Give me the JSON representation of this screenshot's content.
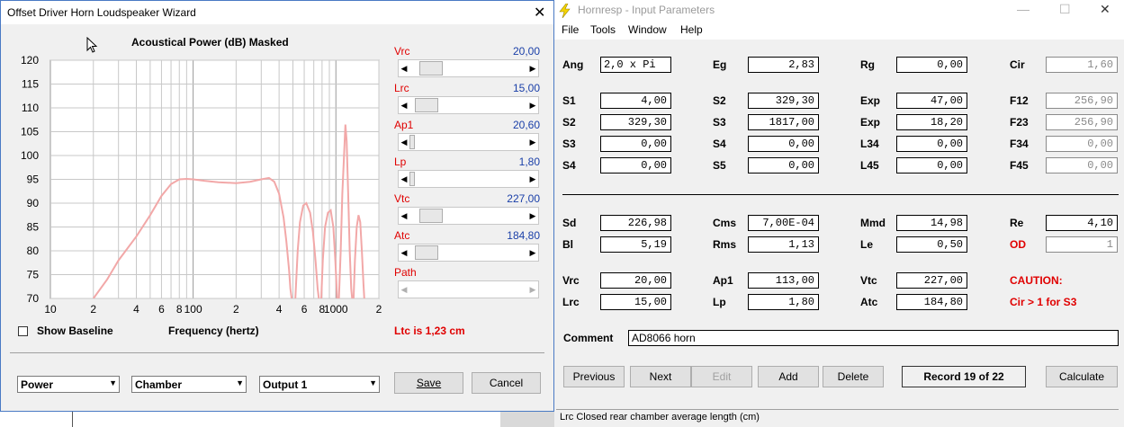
{
  "hornresp": {
    "title": "Hornresp - Input Parameters",
    "menu": [
      "File",
      "Tools",
      "Window",
      "Help"
    ],
    "row1": [
      {
        "label": "Ang",
        "value": "2,0 x Pi",
        "left": true
      },
      {
        "label": "Eg",
        "value": "2,83"
      },
      {
        "label": "Rg",
        "value": "0,00"
      },
      {
        "label": "Cir",
        "value": "1,60",
        "gray": true
      }
    ],
    "horn_rows": [
      [
        {
          "label": "S1",
          "value": "4,00"
        },
        {
          "label": "S2",
          "value": "329,30"
        },
        {
          "label": "Exp",
          "value": "47,00"
        },
        {
          "label": "F12",
          "value": "256,90",
          "gray": true
        }
      ],
      [
        {
          "label": "S2",
          "value": "329,30"
        },
        {
          "label": "S3",
          "value": "1817,00"
        },
        {
          "label": "Exp",
          "value": "18,20"
        },
        {
          "label": "F23",
          "value": "256,90",
          "gray": true
        }
      ],
      [
        {
          "label": "S3",
          "value": "0,00"
        },
        {
          "label": "S4",
          "value": "0,00"
        },
        {
          "label": "L34",
          "value": "0,00"
        },
        {
          "label": "F34",
          "value": "0,00",
          "gray": true
        }
      ],
      [
        {
          "label": "S4",
          "value": "0,00"
        },
        {
          "label": "S5",
          "value": "0,00"
        },
        {
          "label": "L45",
          "value": "0,00"
        },
        {
          "label": "F45",
          "value": "0,00",
          "gray": true
        }
      ]
    ],
    "driver_rows": [
      [
        {
          "label": "Sd",
          "value": "226,98"
        },
        {
          "label": "Cms",
          "value": "7,00E-04"
        },
        {
          "label": "Mmd",
          "value": "14,98"
        },
        {
          "label": "Re",
          "value": "4,10"
        }
      ],
      [
        {
          "label": "Bl",
          "value": "5,19"
        },
        {
          "label": "Rms",
          "value": "1,13"
        },
        {
          "label": "Le",
          "value": "0,50"
        },
        {
          "label": "OD",
          "value": "1",
          "red": true,
          "gray": true
        }
      ]
    ],
    "chamber_rows": [
      [
        {
          "label": "Vrc",
          "value": "20,00"
        },
        {
          "label": "Ap1",
          "value": "113,00"
        },
        {
          "label": "Vtc",
          "value": "227,00"
        }
      ],
      [
        {
          "label": "Lrc",
          "value": "15,00"
        },
        {
          "label": "Lp",
          "value": "1,80"
        },
        {
          "label": "Atc",
          "value": "184,80"
        }
      ]
    ],
    "caution_title": "CAUTION:",
    "caution_text": "Cir > 1 for S3",
    "comment_label": "Comment",
    "comment_value": "AD8066 horn",
    "buttons": {
      "previous": "Previous",
      "next": "Next",
      "edit": "Edit",
      "add": "Add",
      "delete": "Delete",
      "record": "Record 19 of 22",
      "calculate": "Calculate"
    },
    "status": "Lrc    Closed rear chamber average length  (cm)"
  },
  "wizard": {
    "title": "Offset Driver Horn Loudspeaker Wizard",
    "chart_title": "Acoustical Power (dB)   Masked",
    "show_baseline": "Show Baseline",
    "freq_label": "Frequency (hertz)",
    "ltc_text": "Ltc is 1,23 cm",
    "params": [
      {
        "label": "Vrc",
        "value": "20,00",
        "pos": 0.1
      },
      {
        "label": "Lrc",
        "value": "15,00",
        "pos": 0.06
      },
      {
        "label": "Ap1",
        "value": "20,60",
        "pos": 0.0
      },
      {
        "label": "Lp",
        "value": "1,80",
        "pos": 0.0
      },
      {
        "label": "Vtc",
        "value": "227,00",
        "pos": 0.1
      },
      {
        "label": "Atc",
        "value": "184,80",
        "pos": 0.06
      },
      {
        "label": "Path",
        "value": "",
        "pos": null
      }
    ],
    "combos": [
      "Power",
      "Chamber",
      "Output 1"
    ],
    "save": "Save",
    "cancel": "Cancel"
  },
  "chart_data": {
    "type": "line",
    "title": "Acoustical Power (dB)   Masked",
    "xlabel": "Frequency (hertz)",
    "ylabel": "",
    "xscale": "log",
    "xlim": [
      10,
      2000
    ],
    "ylim": [
      70,
      120
    ],
    "yticks": [
      70,
      75,
      80,
      85,
      90,
      95,
      100,
      105,
      110,
      115,
      120
    ],
    "xtick_labels": [
      {
        "v": 10,
        "t": "10"
      },
      {
        "v": 20,
        "t": "2"
      },
      {
        "v": 40,
        "t": "4"
      },
      {
        "v": 60,
        "t": "6"
      },
      {
        "v": 80,
        "t": "8"
      },
      {
        "v": 100,
        "t": "100"
      },
      {
        "v": 200,
        "t": "2"
      },
      {
        "v": 400,
        "t": "4"
      },
      {
        "v": 600,
        "t": "6"
      },
      {
        "v": 800,
        "t": "8"
      },
      {
        "v": 1000,
        "t": "1000"
      },
      {
        "v": 2000,
        "t": "2"
      }
    ],
    "grid": true,
    "color": "#f2a8a8",
    "series": [
      {
        "points": [
          [
            20,
            70
          ],
          [
            25,
            74
          ],
          [
            30,
            78
          ],
          [
            40,
            83
          ],
          [
            50,
            87.5
          ],
          [
            60,
            91.5
          ],
          [
            70,
            94
          ],
          [
            80,
            95
          ],
          [
            90,
            95.1
          ],
          [
            100,
            95
          ],
          [
            120,
            94.7
          ],
          [
            150,
            94.4
          ],
          [
            200,
            94.2
          ],
          [
            250,
            94.5
          ],
          [
            300,
            95
          ],
          [
            340,
            95.3
          ],
          [
            370,
            94.5
          ],
          [
            400,
            92
          ],
          [
            430,
            87
          ],
          [
            450,
            82
          ],
          [
            470,
            76
          ],
          [
            480,
            72
          ],
          [
            490,
            70
          ]
        ]
      },
      {
        "points": [
          [
            520,
            70
          ],
          [
            540,
            80
          ],
          [
            560,
            86
          ],
          [
            590,
            89.5
          ],
          [
            620,
            90
          ],
          [
            660,
            88
          ],
          [
            690,
            84
          ],
          [
            720,
            78
          ],
          [
            745,
            72
          ],
          [
            760,
            70
          ]
        ]
      },
      {
        "points": [
          [
            790,
            70
          ],
          [
            810,
            78
          ],
          [
            840,
            85
          ],
          [
            880,
            88
          ],
          [
            920,
            88.5
          ],
          [
            960,
            85
          ],
          [
            990,
            78
          ],
          [
            1010,
            73
          ],
          [
            1020,
            70
          ]
        ]
      },
      {
        "points": [
          [
            1050,
            70
          ],
          [
            1080,
            80
          ],
          [
            1110,
            92
          ],
          [
            1140,
            100
          ],
          [
            1165,
            106.5
          ],
          [
            1190,
            103
          ],
          [
            1220,
            92
          ],
          [
            1250,
            80
          ],
          [
            1280,
            72
          ],
          [
            1300,
            70
          ]
        ]
      },
      {
        "points": [
          [
            1330,
            70
          ],
          [
            1360,
            78
          ],
          [
            1400,
            85
          ],
          [
            1440,
            87.5
          ],
          [
            1480,
            86
          ],
          [
            1520,
            80
          ],
          [
            1560,
            73
          ],
          [
            1580,
            70
          ]
        ]
      }
    ]
  }
}
